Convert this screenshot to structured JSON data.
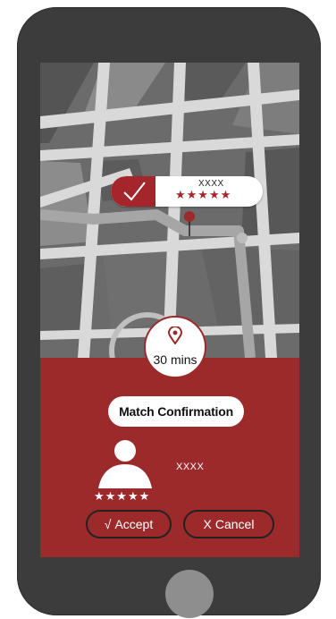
{
  "driver_card": {
    "name": "XXXX",
    "stars": "★★★★★",
    "icon": "checkmark-icon"
  },
  "eta": {
    "icon": "location-pin-icon",
    "label": "30 mins"
  },
  "match": {
    "title": "Match Confirmation"
  },
  "user": {
    "name": "XXXX",
    "stars": "★★★★★",
    "icon": "user-avatar-icon"
  },
  "actions": {
    "accept_glyph": "√",
    "accept_label": "Accept",
    "cancel_glyph": "X",
    "cancel_label": "Cancel"
  },
  "colors": {
    "accent": "#9d2a2b",
    "phone_body": "#3c3c3c",
    "map_background": "#6b6b6b",
    "road": "#d9d9d9",
    "route": "#9d9d9d"
  }
}
